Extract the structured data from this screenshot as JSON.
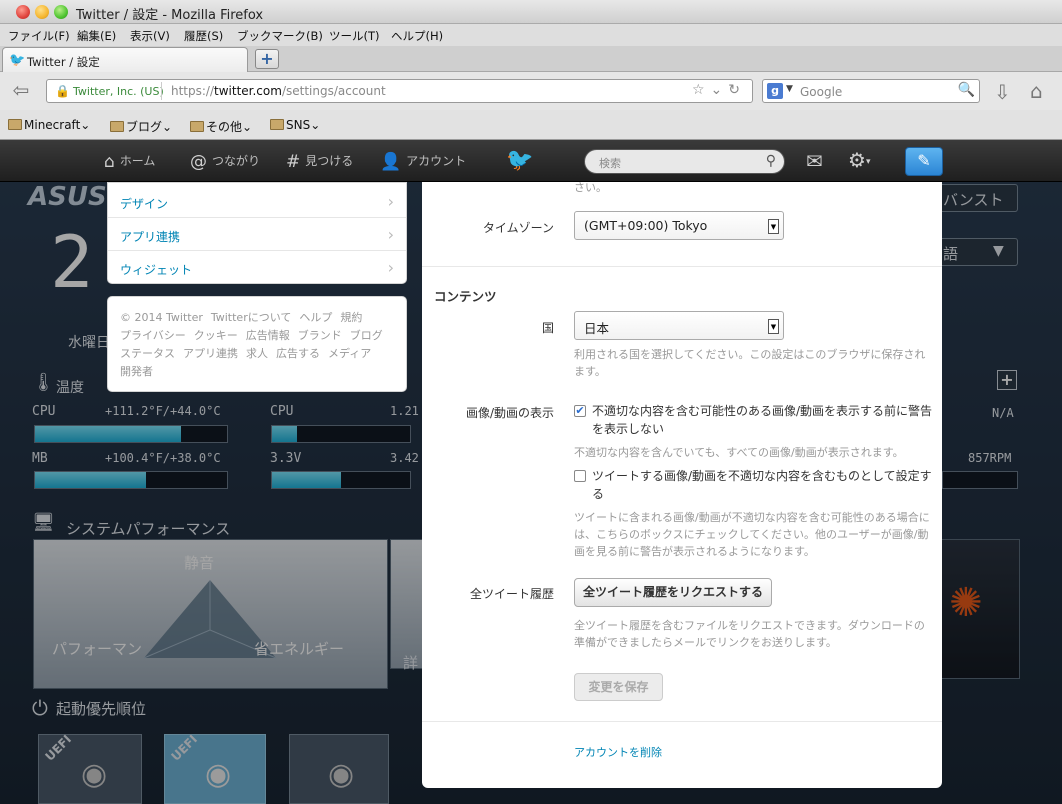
{
  "window": {
    "title": "Twitter / 設定 - Mozilla Firefox"
  },
  "menubar": [
    "ファイル(F)",
    "編集(E)",
    "表示(V)",
    "履歴(S)",
    "ブックマーク(B)",
    "ツール(T)",
    "ヘルプ(H)"
  ],
  "tab": {
    "label": "Twitter / 設定",
    "new_tab": "+"
  },
  "urlbar": {
    "site_identity": "Twitter, Inc. (US)",
    "url_prefix": "https://",
    "url_host": "twitter.com",
    "url_path": "/settings/account"
  },
  "searchbar": {
    "engine": "Google"
  },
  "bookmarks": [
    "Minecraft",
    "ブログ",
    "その他",
    "SNS"
  ],
  "background": {
    "brand": "ASUS",
    "advanced": "バンスト",
    "language": "語",
    "clock": "2",
    "weekday": "水曜日",
    "temp_title": "温度",
    "cpu_label": "CPU",
    "cpu_temp": "+111.2°F/+44.0°C",
    "mb_label": "MB",
    "mb_temp": "+100.4°F/+38.0°C",
    "cpu_v_label": "CPU",
    "cpu_v": "1.21",
    "v33_label": "3.3V",
    "v33": "3.42",
    "na": "N/A",
    "rpm": "857RPM",
    "perf_title": "システムパフォーマンス",
    "quiet": "静音",
    "performance": "パフォーマン",
    "energy": "省エネルギー",
    "detail": "詳",
    "boot_title": "起動優先順位",
    "uefi": "UEFI",
    "plus": "+",
    "cpu_bar": 0.76,
    "mb_bar": 0.58,
    "cpu_v_bar": 0.18,
    "v33_bar": 0.5
  },
  "twitter_nav": {
    "home": "ホーム",
    "connect": "つながり",
    "discover": "見つける",
    "account": "アカウント",
    "search_placeholder": "検索"
  },
  "left_menu": [
    "デザイン",
    "アプリ連携",
    "ウィジェット"
  ],
  "footer": [
    "© 2014 Twitter",
    "Twitterについて",
    "ヘルプ",
    "規約",
    "プライバシー",
    "クッキー",
    "広告情報",
    "ブランド",
    "ブログ",
    "ステータス",
    "アプリ連携",
    "求人",
    "広告する",
    "メディア",
    "開発者"
  ],
  "settings": {
    "top_fragment": "さい。",
    "timezone_label": "タイムゾーン",
    "timezone_value": "(GMT+09:00) Tokyo",
    "content_title": "コンテンツ",
    "country_label": "国",
    "country_value": "日本",
    "country_help": "利用される国を選択してください。この設定はこのブラウザに保存されます。",
    "media_label": "画像/動画の表示",
    "media_check1": "不適切な内容を含む可能性のある画像/動画を表示する前に警告を表示しない",
    "media_check1_help": "不適切な内容を含んでいても、すべての画像/動画が表示されます。",
    "media_check2": "ツイートする画像/動画を不適切な内容を含むものとして設定する",
    "media_check2_help": "ツイートに含まれる画像/動画が不適切な内容を含む可能性のある場合には、こちらのボックスにチェックしてください。他のユーザーが画像/動画を見る前に警告が表示されるようになります。",
    "archive_label": "全ツイート履歴",
    "archive_button": "全ツイート履歴をリクエストする",
    "archive_help": "全ツイート履歴を含むファイルをリクエストできます。ダウンロードの準備ができましたらメールでリンクをお送りします。",
    "save_button": "変更を保存",
    "delete_link": "アカウントを削除",
    "check1_checked": true,
    "check2_checked": false
  }
}
